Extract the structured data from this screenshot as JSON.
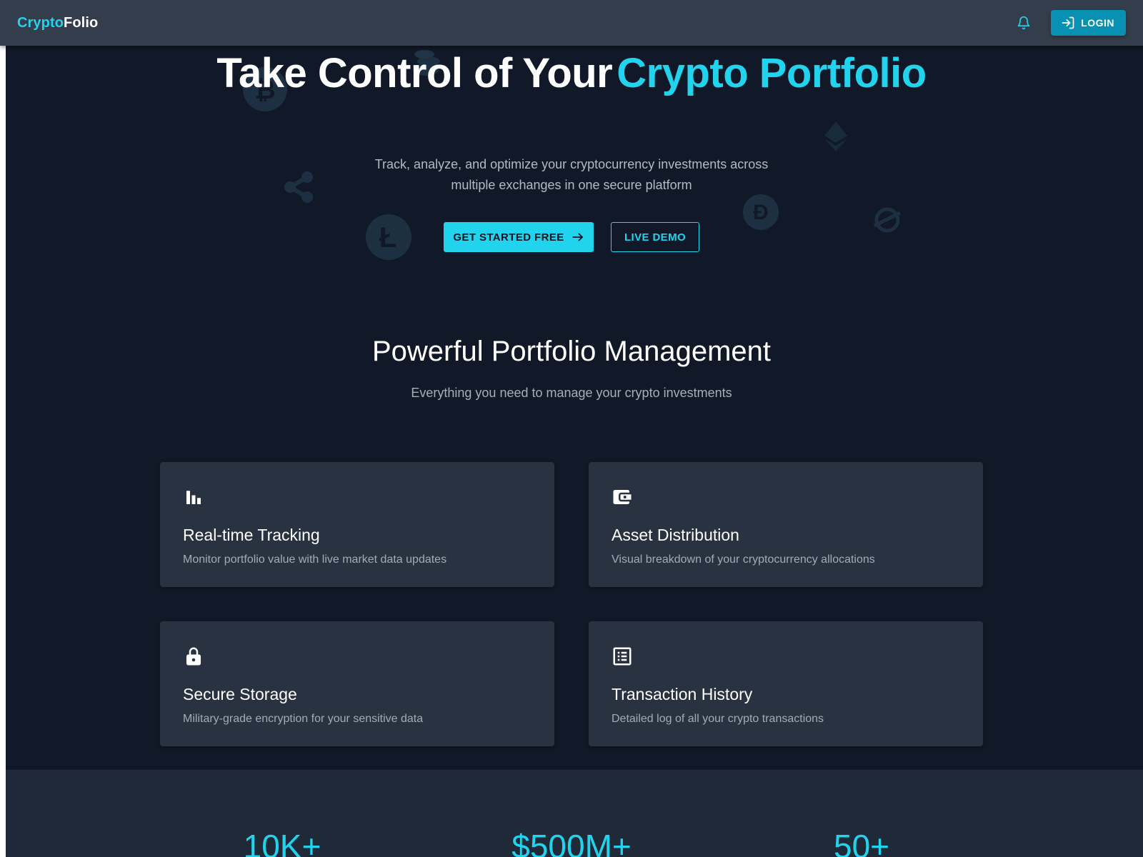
{
  "header": {
    "brand_accent": "Crypto",
    "brand_rest": "Folio",
    "notification_icon": "bell-icon",
    "login_label": "LOGIN",
    "login_icon": "login-icon"
  },
  "hero": {
    "title_part1": "Take Control of Your",
    "title_part2": "Crypto Portfolio",
    "subtitle": "Track, analyze, and optimize your cryptocurrency investments across multiple exchanges in one secure platform",
    "primary_cta": "GET STARTED FREE",
    "primary_cta_icon": "arrow-right-icon",
    "secondary_cta": "LIVE DEMO",
    "background_icons": [
      "bitcoin-icon",
      "coins-icon",
      "ethereum-icon",
      "ripple-icon",
      "litecoin-icon",
      "dogecoin-icon",
      "stellar-icon"
    ]
  },
  "features": {
    "title": "Powerful Portfolio Management",
    "subtitle": "Everything you need to manage your crypto investments",
    "cards": [
      {
        "icon": "bar-chart-icon",
        "title": "Real-time Tracking",
        "description": "Monitor portfolio value with live market data updates"
      },
      {
        "icon": "wallet-icon",
        "title": "Asset Distribution",
        "description": "Visual breakdown of your cryptocurrency allocations"
      },
      {
        "icon": "lock-icon",
        "title": "Secure Storage",
        "description": "Military-grade encryption for your sensitive data"
      },
      {
        "icon": "list-icon",
        "title": "Transaction History",
        "description": "Detailed log of all your crypto transactions"
      }
    ]
  },
  "stats": {
    "items": [
      {
        "value": "10K+"
      },
      {
        "value": "$500M+"
      },
      {
        "value": "50+"
      }
    ]
  },
  "colors": {
    "accent": "#22d3ee",
    "background": "#111827",
    "header": "#343d4b",
    "card": "#293240",
    "login_button": "#0891b2"
  }
}
